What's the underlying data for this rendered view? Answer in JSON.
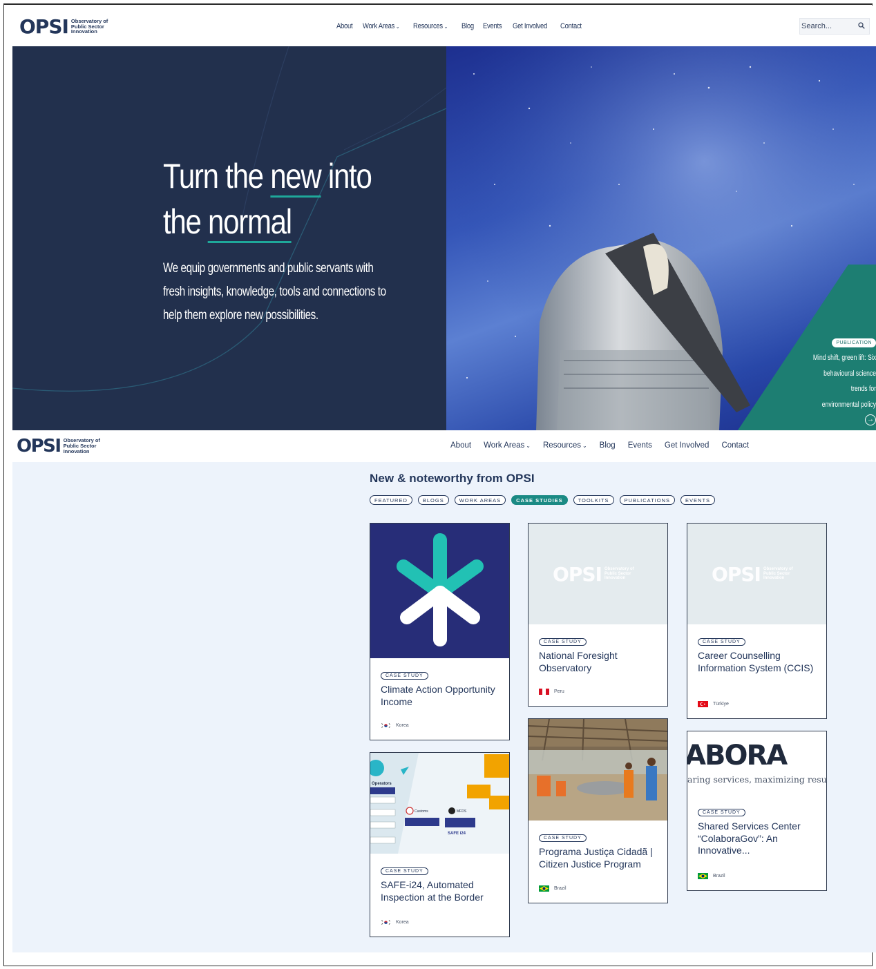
{
  "header": {
    "logo": {
      "mark": "OPSI",
      "subtitle": "Observatory of Public Sector Innovation"
    },
    "nav": [
      {
        "label": "About"
      },
      {
        "label": "Work Areas",
        "dropdown": true
      },
      {
        "label": "Resources",
        "dropdown": true
      },
      {
        "label": "Blog"
      },
      {
        "label": "Events"
      },
      {
        "label": "Get Involved"
      },
      {
        "label": "Contact"
      }
    ],
    "search": {
      "placeholder": "Search..."
    }
  },
  "hero": {
    "title_line1_a": "Turn the ",
    "title_line1_u": "new",
    "title_line1_b": " into",
    "title_line2_a": "the ",
    "title_line2_u": "normal",
    "lead": "We equip governments and public servants with fresh insights, knowledge, tools and connections to help them explore new possibilities.",
    "publication": {
      "tag": "PUBLICATION",
      "title_lines": [
        "Mind shift, green lift: Six",
        "behavioural science trends for",
        "environmental policy"
      ]
    }
  },
  "header2": {
    "logo": {
      "mark": "OPSI",
      "subtitle": "Observatory of Public Sector Innovation"
    },
    "nav": [
      {
        "label": "About"
      },
      {
        "label": "Work Areas",
        "dropdown": true
      },
      {
        "label": "Resources",
        "dropdown": true
      },
      {
        "label": "Blog"
      },
      {
        "label": "Events"
      },
      {
        "label": "Get Involved"
      },
      {
        "label": "Contact"
      }
    ]
  },
  "noteworthy": {
    "title": "New & noteworthy from OPSI",
    "filters": [
      {
        "label": "FEATURED",
        "active": false
      },
      {
        "label": "BLOGS",
        "active": false
      },
      {
        "label": "WORK AREAS",
        "active": false
      },
      {
        "label": "CASE STUDIES",
        "active": true
      },
      {
        "label": "TOOLKITS",
        "active": false
      },
      {
        "label": "PUBLICATIONS",
        "active": false
      },
      {
        "label": "EVENTS",
        "active": false
      }
    ],
    "cards": [
      {
        "tag": "CASE STUDY",
        "title": "Climate Action Opportunity Income",
        "country": "Korea"
      },
      {
        "tag": "CASE STUDY",
        "title": "National Foresight Observatory",
        "country": "Peru"
      },
      {
        "tag": "CASE STUDY",
        "title": "Career Counselling Information System (CCIS)",
        "country": "Türkiye"
      },
      {
        "tag": "CASE STUDY",
        "title": "SAFE-i24, Automated Inspection at the Border",
        "country": "Korea"
      },
      {
        "tag": "CASE STUDY",
        "title": "Programa Justiça Cidadã | Citizen Justice Program",
        "country": "Brazil"
      },
      {
        "tag": "CASE STUDY",
        "title": "Shared Services Center “ColaboraGov”: An Innovative...",
        "country": "Brazil"
      }
    ],
    "thumb_texts": {
      "colabora_big": "ABORA",
      "colabora_sub": "aring services, maximizing resul",
      "safe_operators": "Operators",
      "safe_customs": "Customs",
      "safe_mfds": "MFDS",
      "safe_logo": "SAFE i24"
    }
  },
  "colors": {
    "navy": "#22304d",
    "teal": "#1b8a84",
    "bg_light": "#edf3fb"
  }
}
